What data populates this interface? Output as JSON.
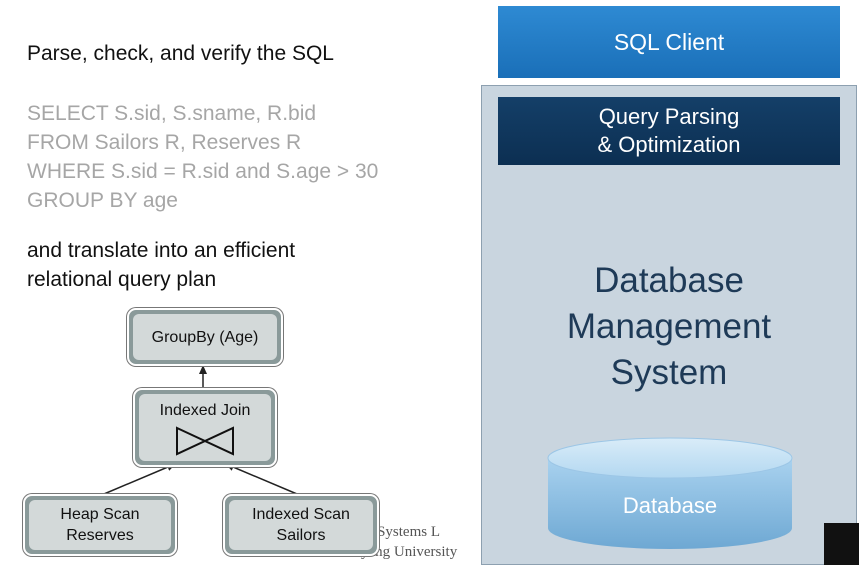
{
  "left": {
    "heading": "Parse, check, and verify the SQL",
    "sql_lines": [
      "SELECT S.sid, S.sname, R.bid",
      "FROM Sailors R, Reserves R",
      "WHERE S.sid = R.sid and S.age > 30",
      "GROUP BY age"
    ],
    "translate_lines": [
      "and translate into an efficient",
      "relational query plan"
    ]
  },
  "plan": {
    "groupby": "GroupBy (Age)",
    "join": "Indexed Join",
    "join_symbol": "bowtie-join-icon",
    "heap_scan": [
      "Heap Scan",
      "Reserves"
    ],
    "indexed_scan": [
      "Indexed Scan",
      "Sailors"
    ]
  },
  "footer": {
    "line1": "ting Systems L",
    "line2": "Hanyang University"
  },
  "stack": {
    "client": "SQL Client",
    "parsing": [
      "Query Parsing",
      "& Optimization"
    ],
    "dbms": [
      "Database",
      "Management",
      "System"
    ],
    "database": "Database"
  },
  "colors": {
    "client_blue": "#1f7ac4",
    "parsing_navy": "#103759",
    "panel": "#c9d5df",
    "cylinder": "#8fbfe0"
  }
}
